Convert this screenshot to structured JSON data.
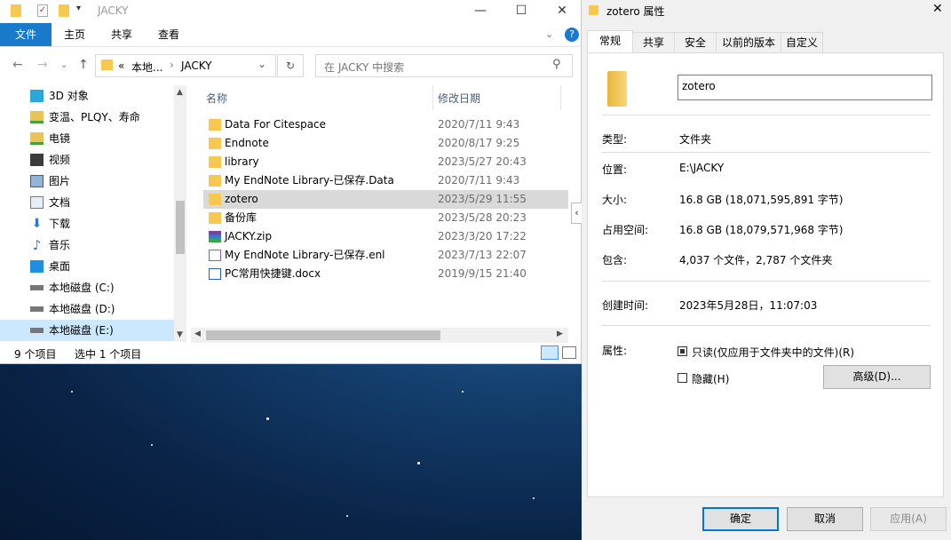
{
  "explorer": {
    "title": "JACKY",
    "window_buttons": [
      "—",
      "☐",
      "✕"
    ],
    "ribbon_tabs": [
      "文件",
      "主页",
      "共享",
      "查看"
    ],
    "breadcrumb": {
      "prefix": "«",
      "parts": [
        "本地...",
        "JACKY"
      ]
    },
    "search_placeholder": "在 JACKY 中搜索",
    "nav_items": [
      {
        "label": "3D 对象",
        "icon": "3d-objects-icon"
      },
      {
        "label": "变温、PLQY、寿命",
        "icon": "network-folder-icon"
      },
      {
        "label": "电镜",
        "icon": "network-folder-icon"
      },
      {
        "label": "视频",
        "icon": "video-icon"
      },
      {
        "label": "图片",
        "icon": "pictures-icon"
      },
      {
        "label": "文档",
        "icon": "documents-icon"
      },
      {
        "label": "下载",
        "icon": "download-icon"
      },
      {
        "label": "音乐",
        "icon": "music-icon"
      },
      {
        "label": "桌面",
        "icon": "desktop-icon"
      },
      {
        "label": "本地磁盘 (C:)",
        "icon": "drive-icon"
      },
      {
        "label": "本地磁盘 (D:)",
        "icon": "drive-icon"
      },
      {
        "label": "本地磁盘 (E:)",
        "icon": "drive-icon"
      }
    ],
    "columns": {
      "name": "名称",
      "date": "修改日期"
    },
    "files": [
      {
        "name": "Data For Citespace",
        "date": "2020/7/11 9:43",
        "icon": "folder-icon"
      },
      {
        "name": "Endnote",
        "date": "2020/8/17 9:25",
        "icon": "folder-icon"
      },
      {
        "name": "library",
        "date": "2023/5/27 20:43",
        "icon": "folder-icon"
      },
      {
        "name": "My EndNote Library-已保存.Data",
        "date": "2020/7/11 9:43",
        "icon": "folder-icon"
      },
      {
        "name": "zotero",
        "date": "2023/5/29 11:55",
        "icon": "folder-icon"
      },
      {
        "name": "备份库",
        "date": "2023/5/28 20:23",
        "icon": "folder-icon"
      },
      {
        "name": "JACKY.zip",
        "date": "2023/3/20 17:22",
        "icon": "zip-icon"
      },
      {
        "name": "My EndNote Library-已保存.enl",
        "date": "2023/7/13 22:07",
        "icon": "enl-file-icon"
      },
      {
        "name": "PC常用快捷键.docx",
        "date": "2019/9/15 21:40",
        "icon": "docx-icon"
      }
    ],
    "status": {
      "count": "9 个项目",
      "selected": "选中 1 个项目"
    }
  },
  "props": {
    "title": "zotero 属性",
    "tabs": [
      "常规",
      "共享",
      "安全",
      "以前的版本",
      "自定义"
    ],
    "name_value": "zotero",
    "rows": {
      "type_label": "类型:",
      "type_value": "文件夹",
      "location_label": "位置:",
      "location_value": "E:\\JACKY",
      "size_label": "大小:",
      "size_value": "16.8 GB (18,071,595,891 字节)",
      "disk_label": "占用空间:",
      "disk_value": "16.8 GB (18,079,571,968 字节)",
      "contains_label": "包含:",
      "contains_value": "4,037 个文件，2,787 个文件夹",
      "created_label": "创建时间:",
      "created_value": "2023年5月28日，11:07:03",
      "attr_label": "属性:"
    },
    "readonly_label": "只读(仅应用于文件夹中的文件)(R)",
    "hidden_label": "隐藏(H)",
    "advanced_label": "高级(D)...",
    "ok_label": "确定",
    "cancel_label": "取消",
    "apply_label": "应用(A)",
    "close_glyph": "✕"
  }
}
